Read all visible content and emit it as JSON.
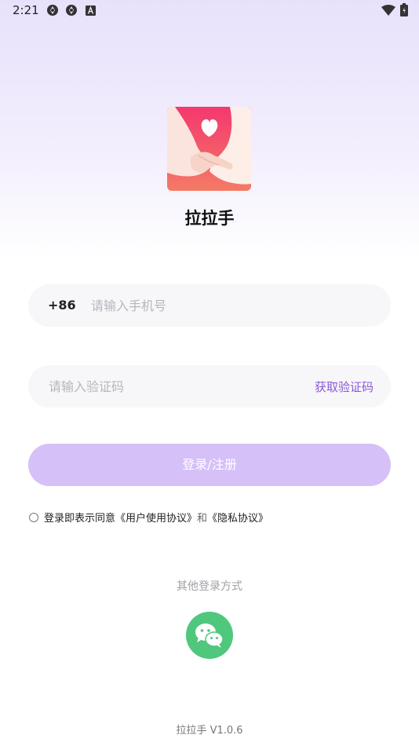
{
  "status_bar": {
    "time": "2:21",
    "left_icons": [
      "sync-icon",
      "sync-icon",
      "font-a-icon"
    ],
    "right_icons": [
      "wifi-icon",
      "battery-icon"
    ]
  },
  "app": {
    "name": "拉拉手",
    "logo_icon": "holding-hands-heart-icon",
    "brand_color": "#f2456e"
  },
  "phone": {
    "country_code": "+86",
    "placeholder": "请输入手机号",
    "value": ""
  },
  "code": {
    "placeholder": "请输入验证码",
    "value": "",
    "get_code_label": "获取验证码"
  },
  "login_button": {
    "label": "登录/注册",
    "color": "#d5c0f7"
  },
  "agreement": {
    "prefix": "登录即表示同意",
    "user_agreement": "《用户使用协议》",
    "connector": "和",
    "privacy_agreement": "《隐私协议》",
    "checked": false
  },
  "other_login": {
    "label": "其他登录方式",
    "wechat_icon": "wechat-icon",
    "wechat_color": "#4fc77d"
  },
  "version": "拉拉手 V1.0.6",
  "accent_color": "#8b59d6"
}
